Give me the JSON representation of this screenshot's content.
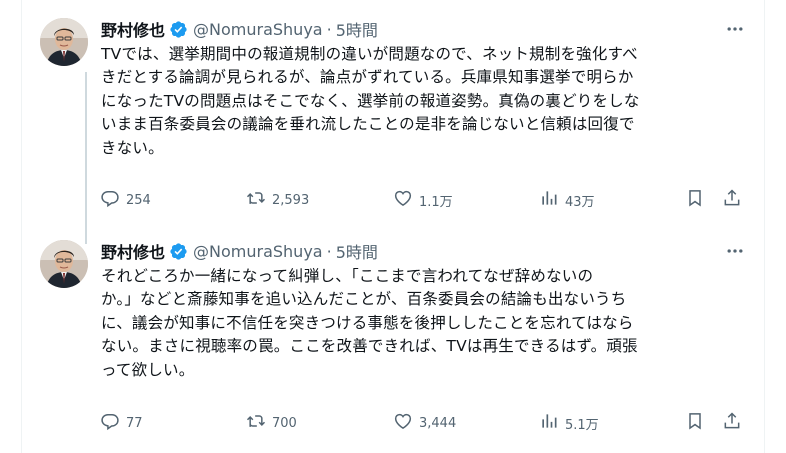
{
  "colors": {
    "text_primary": "#0f1419",
    "text_secondary": "#536471",
    "verified_badge": "#1d9bf0",
    "thread_line": "#cfd9de",
    "border": "#eff3f4"
  },
  "tweets": [
    {
      "display_name": "野村修也",
      "handle": "@NomuraShuya",
      "separator": "·",
      "time": "5時間",
      "verified_icon": "verified-badge-icon",
      "more_icon": "more-horizontal-icon",
      "text_lines": [
        "TVでは、選挙期間中の報道規制の違いが問題なので、ネット規制を強化すべ",
        "きだとする論調が見られるが、論点がずれている。兵庫県知事選挙で明らか",
        "になったTVの問題点はそこでなく、選挙前の報道姿勢。真偽の裏どりをしな",
        "いまま百条委員会の議論を垂れ流したことの是非を論じないと信頼は回復で",
        "きない。"
      ],
      "stats": {
        "replies": "254",
        "reposts": "2,593",
        "likes": "1.1万",
        "views": "43万"
      }
    },
    {
      "display_name": "野村修也",
      "handle": "@NomuraShuya",
      "separator": "·",
      "time": "5時間",
      "verified_icon": "verified-badge-icon",
      "more_icon": "more-horizontal-icon",
      "text_lines": [
        "それどころか一緒になって糾弾し、「ここまで言われてなぜ辞めないの",
        "か。」などと斎藤知事を追い込んだことが、百条委員会の結論も出ないうち",
        "に、議会が知事に不信任を突きつける事態を後押ししたことを忘れてはなら",
        "ない。まさに視聴率の罠。ここを改善できれば、TVは再生できるはず。頑張",
        "って欲しい。"
      ],
      "stats": {
        "replies": "77",
        "reposts": "700",
        "likes": "3,444",
        "views": "5.1万"
      }
    }
  ],
  "action_icons": [
    "reply-icon",
    "repost-icon",
    "like-icon",
    "views-icon",
    "bookmark-icon",
    "share-icon"
  ]
}
